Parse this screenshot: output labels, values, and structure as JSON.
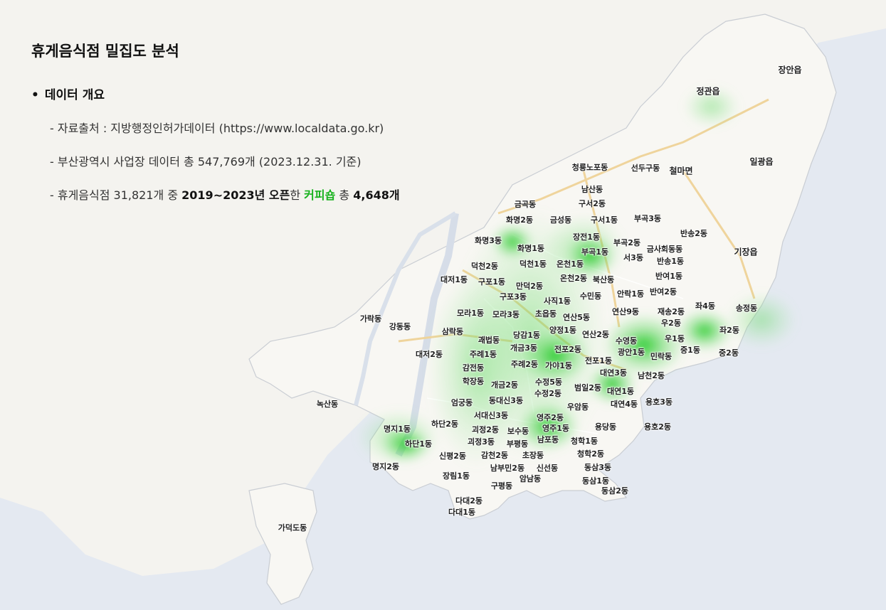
{
  "title": "휴게음식점 밀집도 분석",
  "overview": {
    "heading": "데이터 개요",
    "line1": "- 자료출처 : 지방행정인허가데이터 (https://www.localdata.go.kr)",
    "line2": "- 부산광역시 사업장 데이터 총 547,769개 (2023.12.31. 기준)",
    "line3": {
      "prefix": "- 휴게음식점 31,821개 중 ",
      "period": "2019~2023년 오픈",
      "mid": "한 ",
      "category": "커피숍",
      "mid2": " 총 ",
      "count": "4,648개"
    }
  },
  "colors": {
    "highlight": "#18b21e",
    "heat": "#2fd431",
    "sea": "#e6ebf2",
    "land": "#f6f5f1",
    "road": "#f1cf8e"
  },
  "map": {
    "type": "heatmap overlay on base map",
    "labels": [
      "장안읍",
      "정관읍",
      "일광읍",
      "기장읍",
      "철마면",
      "선두구동",
      "청룡노포동",
      "남산동",
      "구서2동",
      "금곡동",
      "화명2동",
      "금성동",
      "구서1동",
      "부곡3동",
      "반송2동",
      "화명3동",
      "장전1동",
      "부곡2동",
      "금사회동동",
      "화명1동",
      "부곡1동",
      "서3동",
      "반송1동",
      "덕천2동",
      "덕천1동",
      "온천1동",
      "반여1동",
      "대저1동",
      "구포1동",
      "만덕2동",
      "온천2동",
      "북산동",
      "구포3동",
      "사직1동",
      "수민동",
      "안락1동",
      "반여2동",
      "재송2동",
      "좌4동",
      "송정동",
      "가락동",
      "강동동",
      "모라1동",
      "모라3동",
      "초읍동",
      "연산5동",
      "연산9동",
      "우2동",
      "양정1동",
      "좌2동",
      "삼락동",
      "당감1동",
      "연산2동",
      "수영동",
      "우1동",
      "괘법동",
      "개금3동",
      "전포2동",
      "광안1동",
      "민락동",
      "중1동",
      "중2동",
      "대저2동",
      "주례1동",
      "전포1동",
      "주례2동",
      "가야1동",
      "감전동",
      "대연3동",
      "남천2동",
      "학장동",
      "개금2동",
      "수정5동",
      "범일2동",
      "대연1동",
      "수정2동",
      "동대신3동",
      "엄궁동",
      "우암동",
      "대연4동",
      "용호3동",
      "녹산동",
      "서대신3동",
      "하단2동",
      "영주2동",
      "명지1동",
      "괴정2동",
      "보수동",
      "영주1동",
      "용당동",
      "용호2동",
      "하단1동",
      "괴정3동",
      "부평동",
      "남포동",
      "청학1동",
      "신평2동",
      "감천2동",
      "초장동",
      "청학2동",
      "명지2동",
      "남부민2동",
      "신선동",
      "동삼3동",
      "장림1동",
      "암남동",
      "동삼1동",
      "구평동",
      "동삼2동",
      "다대2동",
      "다대1동",
      "가덕도동"
    ]
  }
}
